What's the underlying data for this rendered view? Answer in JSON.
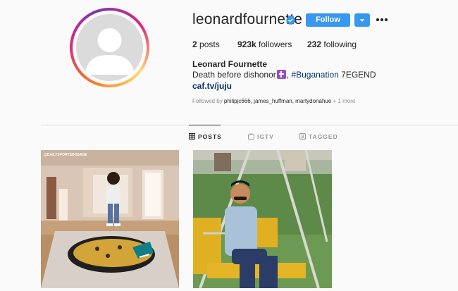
{
  "profile": {
    "username": "leonardfournette",
    "verified_icon": "verified-badge-icon",
    "follow_label": "Follow",
    "dropdown_icon": "caret-down-icon",
    "more_icon": "ellipsis-icon",
    "avatar_icon": "default-avatar-icon"
  },
  "stats": {
    "posts_count": "2",
    "posts_label": " posts",
    "followers_count": "923k",
    "followers_label": " followers",
    "following_count": "232",
    "following_label": " following"
  },
  "bio": {
    "full_name": "Leonard Fournette",
    "text_before": "Death before dishonor",
    "cross_icon": "latin-cross-emoji",
    "hashtag": "#Buganation",
    "text_after": " 7EGEND",
    "link": "caf.tv/juju"
  },
  "followed_by": {
    "prefix": "Followed by ",
    "names": "philipjc666, james_huffman, martydonahue",
    "more": " + 1 more"
  },
  "tabs": [
    {
      "label": "POSTS",
      "icon": "grid-icon",
      "active": true
    },
    {
      "label": "IGTV",
      "icon": "tv-icon",
      "active": false
    },
    {
      "label": "TAGGED",
      "icon": "tag-icon",
      "active": false
    }
  ],
  "posts": [
    {
      "watermark": "@DAILYSPORTSDOSAGE",
      "description": "meme-image-jaguars-logo"
    },
    {
      "description": "meme-image-man-on-swing"
    }
  ],
  "colors": {
    "accent": "#3897f0",
    "link": "#003569",
    "muted": "#8e8e8e"
  }
}
